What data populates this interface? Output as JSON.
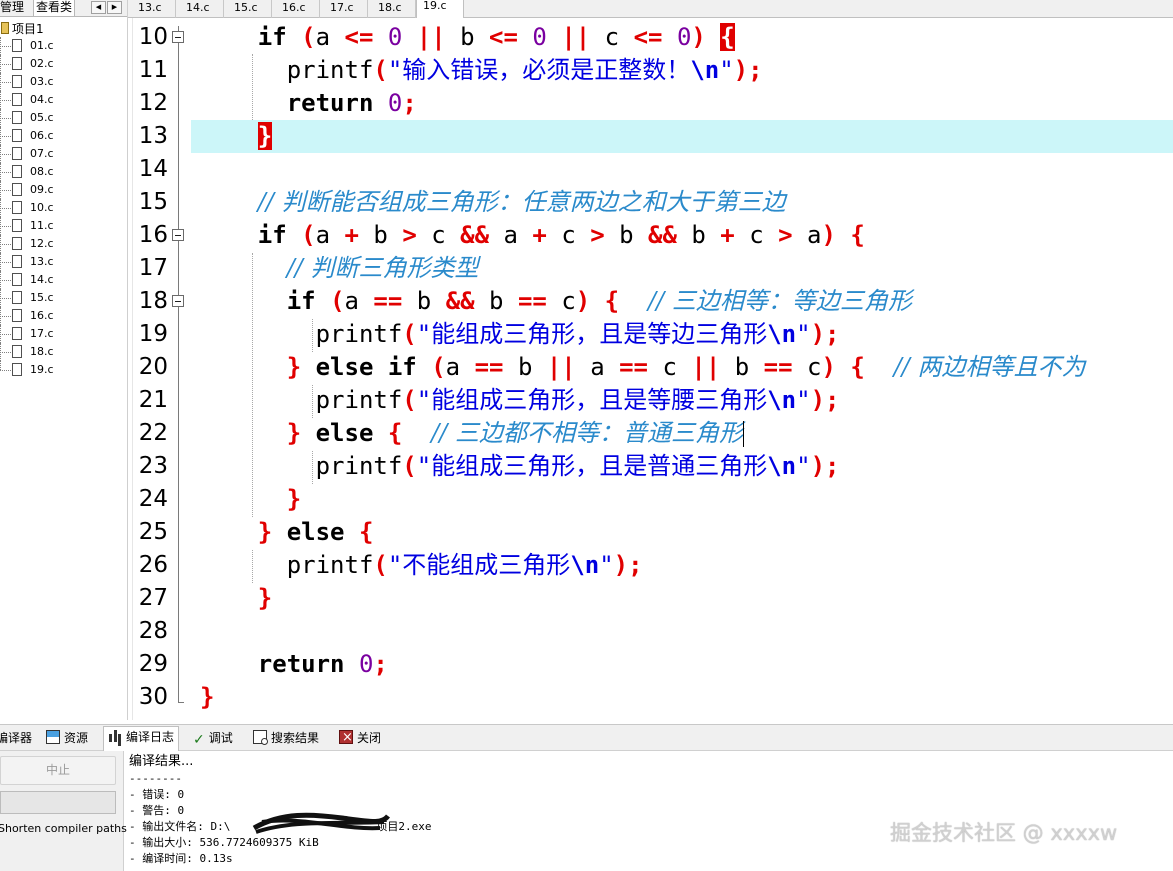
{
  "left_panel": {
    "tabs": [
      "管理",
      "查看类"
    ],
    "root": "项目1",
    "files": [
      "01.c",
      "02.c",
      "03.c",
      "04.c",
      "05.c",
      "06.c",
      "07.c",
      "08.c",
      "09.c",
      "10.c",
      "11.c",
      "12.c",
      "13.c",
      "14.c",
      "15.c",
      "16.c",
      "17.c",
      "18.c",
      "19.c"
    ]
  },
  "file_tabs": [
    "13.c",
    "14.c",
    "15.c",
    "16.c",
    "17.c",
    "18.c",
    "19.c"
  ],
  "active_file_tab": "19.c",
  "editor": {
    "line_numbers": [
      "10",
      "11",
      "12",
      "13",
      "14",
      "15",
      "16",
      "17",
      "18",
      "19",
      "20",
      "21",
      "22",
      "23",
      "24",
      "25",
      "26",
      "27",
      "28",
      "29",
      "30"
    ],
    "code": {
      "l10": {
        "kw_if": "if",
        "a": "a",
        "op1": "<=",
        "n1": "0",
        "or1": "||",
        "b": "b",
        "op2": "<=",
        "n2": "0",
        "or2": "||",
        "c": "c",
        "op3": "<=",
        "n3": "0"
      },
      "l11": {
        "fn": "printf",
        "str": "\"输入错误，必须是正整数！",
        "esc": "\\n",
        "end": "\""
      },
      "l12": {
        "kw": "return",
        "num": "0"
      },
      "l15": {
        "comment": "// 判断能否组成三角形：任意两边之和大于第三边"
      },
      "l16": {
        "kw_if": "if",
        "t1": "a",
        "p1": "+",
        "t2": "b",
        "g1": ">",
        "t3": "c",
        "and1": "&&",
        "t4": "a",
        "p2": "+",
        "t5": "c",
        "g2": ">",
        "t6": "b",
        "and2": "&&",
        "t7": "b",
        "p3": "+",
        "t8": "c",
        "g3": ">",
        "t9": "a"
      },
      "l17": {
        "comment": "// 判断三角形类型"
      },
      "l18": {
        "kw_if": "if",
        "t1": "a",
        "eq1": "==",
        "t2": "b",
        "and1": "&&",
        "t3": "b",
        "eq2": "==",
        "t4": "c",
        "comment": "// 三边相等：等边三角形"
      },
      "l19": {
        "fn": "printf",
        "str": "\"能组成三角形，且是等边三角形",
        "esc": "\\n",
        "end": "\""
      },
      "l20": {
        "kw_else": "else",
        "kw_if": "if",
        "t1": "a",
        "eq1": "==",
        "t2": "b",
        "or1": "||",
        "t3": "a",
        "eq2": "==",
        "t4": "c",
        "or2": "||",
        "t5": "b",
        "eq3": "==",
        "t6": "c",
        "comment": "// 两边相等且不为"
      },
      "l21": {
        "fn": "printf",
        "str": "\"能组成三角形，且是等腰三角形",
        "esc": "\\n",
        "end": "\""
      },
      "l22": {
        "kw_else": "else",
        "comment": "// 三边都不相等：普通三角形"
      },
      "l23": {
        "fn": "printf",
        "str": "\"能组成三角形，且是普通三角形",
        "esc": "\\n",
        "end": "\""
      },
      "l25": {
        "kw_else": "else"
      },
      "l26": {
        "fn": "printf",
        "str": "\"不能组成三角形",
        "esc": "\\n",
        "end": "\""
      },
      "l29": {
        "kw": "return",
        "num": "0"
      }
    }
  },
  "bottom_tabs": [
    "编译器",
    "资源",
    "编译日志",
    "调试",
    "搜索结果",
    "关闭"
  ],
  "active_bottom_tab": "编译日志",
  "bottom_left": {
    "abort_button": "中止",
    "shorten_label": "Shorten compiler paths"
  },
  "compile_log": {
    "title": "编译结果...",
    "separator": "--------",
    "errors": "- 错误: 0",
    "warnings": "- 警告: 0",
    "output_file_prefix": "- 输出文件名: D:\\",
    "output_file_suffix": "项目2.exe",
    "output_size": "- 输出大小: 536.7724609375 KiB",
    "compile_time": "- 编译时间: 0.13s"
  },
  "watermark": "掘金技术社区 @ xxxxw",
  "colors": {
    "highlight_line": "#ccf6f9",
    "operator_red": "#e00000",
    "string_blue": "#0000e0",
    "comment_blue": "#2a8acb",
    "number_purple": "#7a00a0"
  }
}
